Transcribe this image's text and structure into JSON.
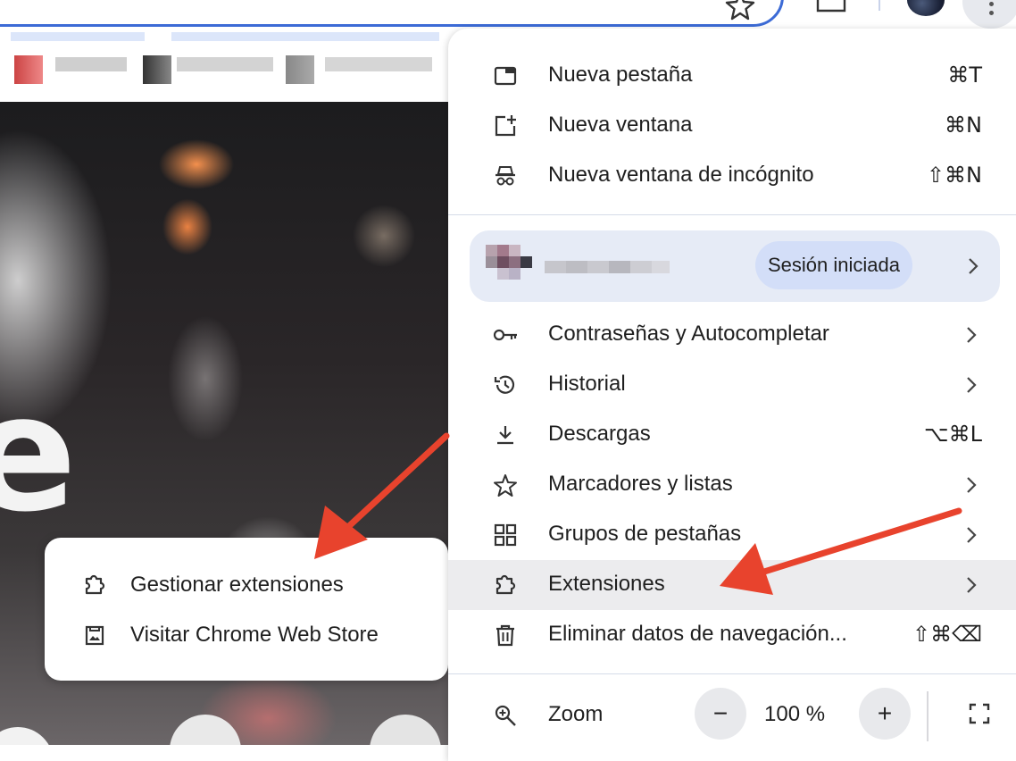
{
  "menu": {
    "items_top": [
      {
        "label": "Nueva pestaña",
        "shortcut": "⌘T",
        "icon": "new-tab-icon"
      },
      {
        "label": "Nueva ventana",
        "shortcut": "⌘N",
        "icon": "new-window-icon"
      },
      {
        "label": "Nueva ventana de incógnito",
        "shortcut": "⇧⌘N",
        "icon": "incognito-icon"
      }
    ],
    "profile": {
      "status": "Sesión iniciada"
    },
    "items": [
      {
        "label": "Contraseñas y Autocompletar",
        "icon": "key-icon",
        "has_submenu": true
      },
      {
        "label": "Historial",
        "icon": "history-icon",
        "has_submenu": true
      },
      {
        "label": "Descargas",
        "shortcut": "⌥⌘L",
        "icon": "download-icon"
      },
      {
        "label": "Marcadores y listas",
        "icon": "star-icon",
        "has_submenu": true
      },
      {
        "label": "Grupos de pestañas",
        "icon": "tab-groups-icon",
        "has_submenu": true
      },
      {
        "label": "Extensiones",
        "icon": "puzzle-icon",
        "has_submenu": true,
        "highlighted": true
      },
      {
        "label": "Eliminar datos de navegación...",
        "shortcut": "⇧⌘⌫",
        "icon": "trash-icon"
      }
    ],
    "zoom": {
      "label": "Zoom",
      "value": "100 %",
      "minus": "−",
      "plus": "+"
    }
  },
  "extensions_submenu": {
    "items": [
      {
        "label": "Gestionar extensiones",
        "icon": "puzzle-icon"
      },
      {
        "label": "Visitar Chrome Web Store",
        "icon": "web-store-icon"
      }
    ]
  },
  "colors": {
    "accent": "#3c6bd6",
    "arrow": "#e8432d",
    "highlight": "#ececee",
    "profile_bg": "#e6ebf6"
  }
}
